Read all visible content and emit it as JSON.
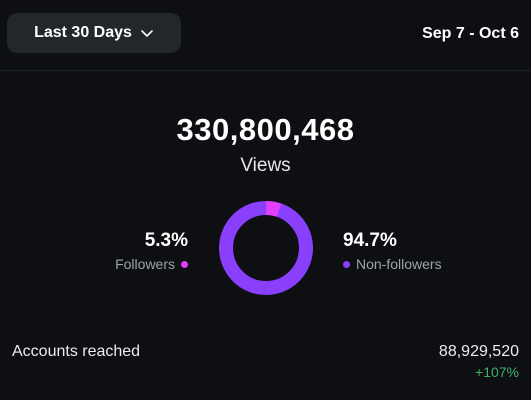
{
  "header": {
    "range_selector_label": "Last 30 Days",
    "date_range": "Sep 7 - Oct 6"
  },
  "summary": {
    "views_count": "330,800,468",
    "views_label": "Views"
  },
  "breakdown": {
    "followers": {
      "percent": "5.3%",
      "label": "Followers",
      "color": "#e040fb",
      "fraction": 0.053
    },
    "non_followers": {
      "percent": "94.7%",
      "label": "Non-followers",
      "color": "#8a3ffc",
      "fraction": 0.947
    }
  },
  "accounts_reached": {
    "label": "Accounts reached",
    "value": "88,929,520",
    "change": "+107%"
  },
  "icons": {
    "range_chevron": "chevron-down-icon"
  }
}
